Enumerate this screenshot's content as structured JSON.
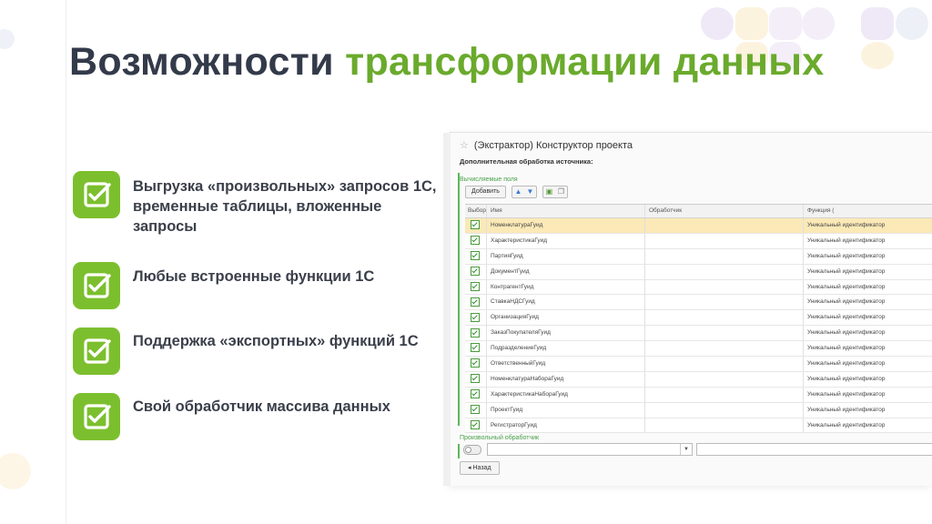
{
  "slide": {
    "title_main": "Возможности",
    "title_accent": "трансформации данных",
    "accent_color": "#6aaa2c",
    "features": [
      {
        "icon": "checkbox-icon",
        "text": "Выгрузка «произвольных» запросов 1С, временные таблицы, вложенные запросы"
      },
      {
        "icon": "checkbox-icon",
        "text": "Любые встроенные функции 1С"
      },
      {
        "icon": "checkbox-icon",
        "text": "Поддержка «экспортных» функций 1С"
      },
      {
        "icon": "checkbox-icon",
        "text": "Свой обработчик массива данных"
      }
    ]
  },
  "window": {
    "title": "(Экстрактор) Конструктор проекта",
    "subtitle": "Дополнительная обработка источника:",
    "group_label": "Вычисляемые поля",
    "add_button": "Добавить",
    "columns": [
      "Выбор",
      "Имя",
      "Обработчик",
      "Функция ("
    ],
    "rows": [
      {
        "name": "НоменклатураГуид",
        "handler": "",
        "function": "Уникальный идентификатор",
        "checked": true,
        "selected": true
      },
      {
        "name": "ХарактеристикаГуид",
        "handler": "",
        "function": "Уникальный идентификатор",
        "checked": true,
        "selected": false
      },
      {
        "name": "ПартияГуид",
        "handler": "",
        "function": "Уникальный идентификатор",
        "checked": true,
        "selected": false
      },
      {
        "name": "ДокументГуид",
        "handler": "",
        "function": "Уникальный идентификатор",
        "checked": true,
        "selected": false
      },
      {
        "name": "КонтрагентГуид",
        "handler": "",
        "function": "Уникальный идентификатор",
        "checked": true,
        "selected": false
      },
      {
        "name": "СтавкаНДСГуид",
        "handler": "",
        "function": "Уникальный идентификатор",
        "checked": true,
        "selected": false
      },
      {
        "name": "ОрганизацияГуид",
        "handler": "",
        "function": "Уникальный идентификатор",
        "checked": true,
        "selected": false
      },
      {
        "name": "ЗаказПокупателяГуид",
        "handler": "",
        "function": "Уникальный идентификатор",
        "checked": true,
        "selected": false
      },
      {
        "name": "ПодразделениеГуид",
        "handler": "",
        "function": "Уникальный идентификатор",
        "checked": true,
        "selected": false
      },
      {
        "name": "ОтветственныйГуид",
        "handler": "",
        "function": "Уникальный идентификатор",
        "checked": true,
        "selected": false
      },
      {
        "name": "НоменклатураНабораГуид",
        "handler": "",
        "function": "Уникальный идентификатор",
        "checked": true,
        "selected": false
      },
      {
        "name": "ХарактеристикаНабораГуид",
        "handler": "",
        "function": "Уникальный идентификатор",
        "checked": true,
        "selected": false
      },
      {
        "name": "ПроектГуид",
        "handler": "",
        "function": "Уникальный идентификатор",
        "checked": true,
        "selected": false
      },
      {
        "name": "РегистраторГуид",
        "handler": "",
        "function": "Уникальный идентификатор",
        "checked": true,
        "selected": false
      }
    ],
    "custom_handler_label": "Произвольный обработчик",
    "back_button": "Назад"
  }
}
